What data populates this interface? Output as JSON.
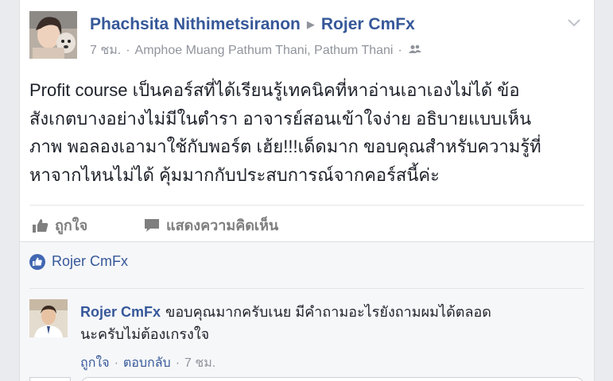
{
  "post": {
    "author": "Phachsita Nithimetsiranon",
    "target": "Rojer CmFx",
    "time": "7 ชม.",
    "location": "Amphoe Muang Pathum Thani, Pathum Thani",
    "separator": "·",
    "text_lines": [
      "Profit course เป็นคอร์สที่ได้เรียนรู้เทคนิคที่หาอ่านเอาเองไม่ได้ ข้อ",
      "สังเกตบางอย่างไม่มีในตำรา อาจารย์สอนเข้าใจง่าย อธิบายแบบเห็น",
      "ภาพ พอลองเอามาใช้กับพอร์ต เฮ้ย!!!เด็ดมาก ขอบคุณสำหรับความรู้ที่",
      "หาจากไหนไม่ได้ คุ้มมากกับประสบการณ์จากคอร์สนี้ค่ะ"
    ]
  },
  "actions": {
    "like_label": "ถูกใจ",
    "comment_label": "แสดงความคิดเห็น"
  },
  "likes": {
    "liker": "Rojer CmFx"
  },
  "comment": {
    "author": "Rojer CmFx",
    "text_line1": "ขอบคุณมากครับเนย มีคำถามอะไรยังถามผมได้ตลอด",
    "text_line2": "นะครับไม่ต้องเกรงใจ",
    "like_label": "ถูกใจ",
    "reply_label": "ตอบกลับ",
    "time": "7 ชม.",
    "separator": "·"
  },
  "colors": {
    "link": "#365899",
    "muted": "#90949c",
    "like_blue": "#4267b2"
  },
  "icons": [
    "chevron-down-icon",
    "friends-icon",
    "like-thumb-icon",
    "comment-bubble-icon",
    "like-badge-icon"
  ]
}
